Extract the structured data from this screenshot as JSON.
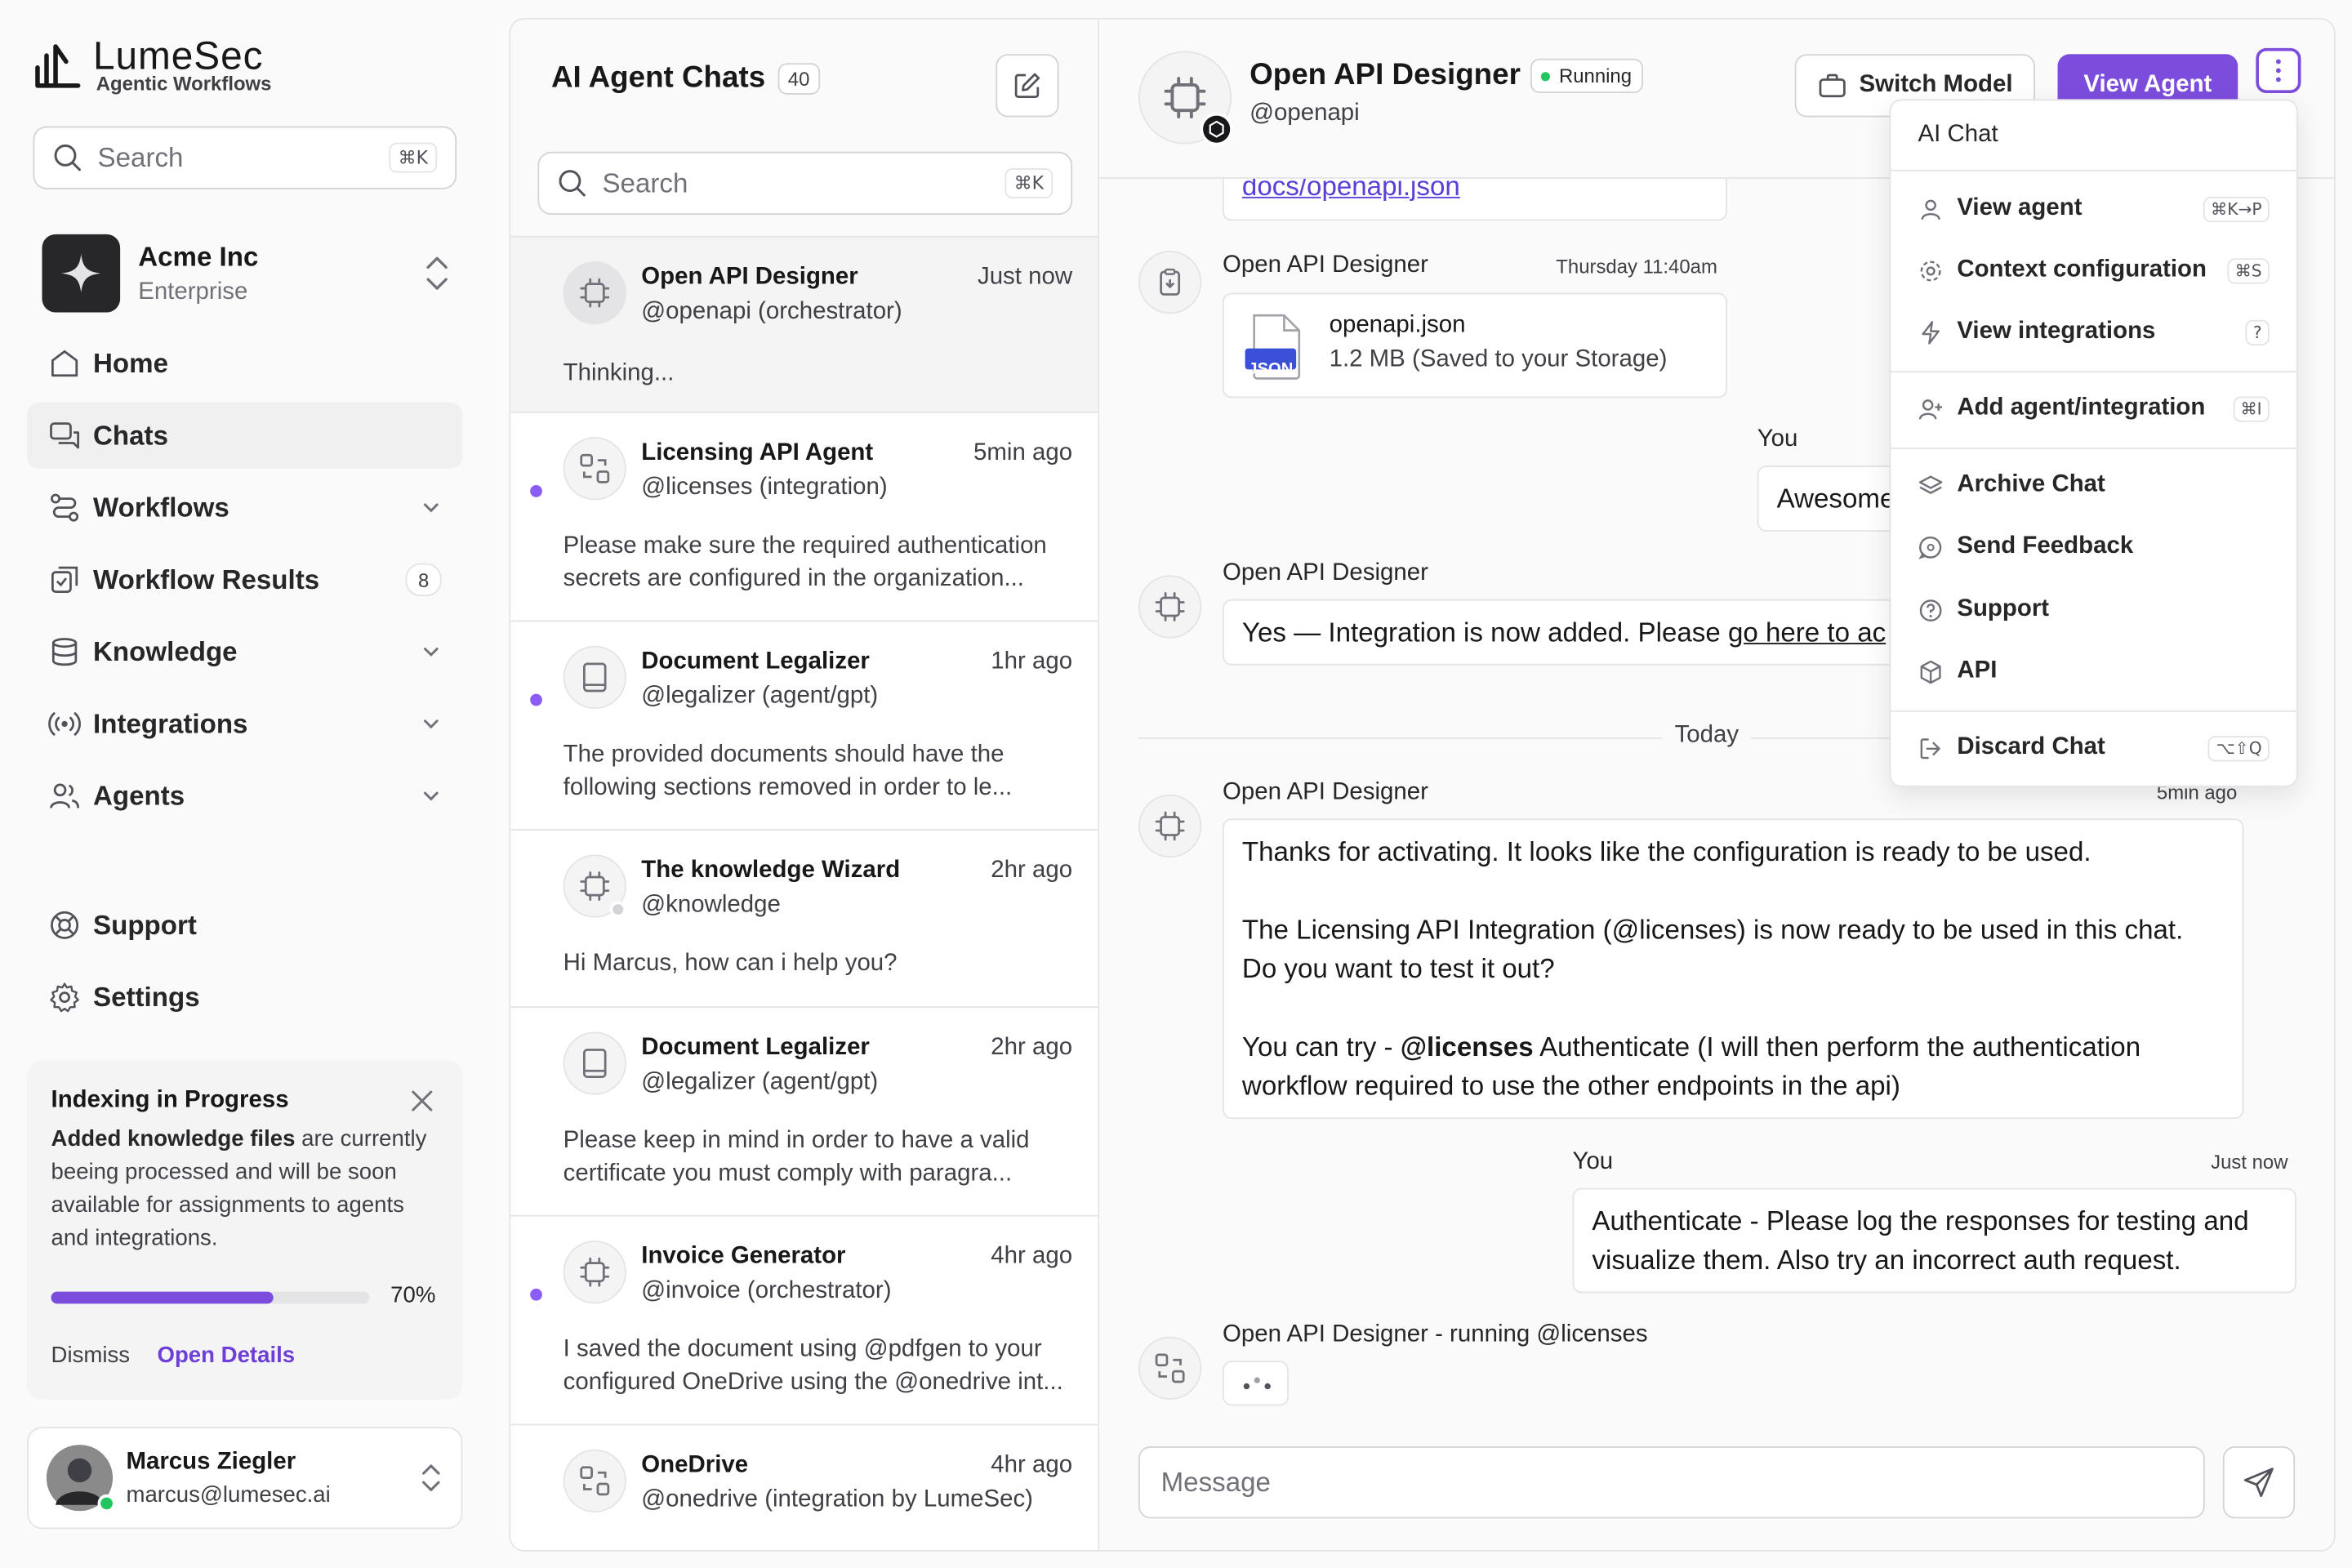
{
  "brand": {
    "name": "LumeSec",
    "tagline": "Agentic Workflows"
  },
  "sidebar": {
    "search": {
      "placeholder": "Search",
      "shortcut": "⌘K"
    },
    "org": {
      "name": "Acme Inc",
      "tier": "Enterprise"
    },
    "nav": [
      {
        "label": "Home",
        "icon": "home-icon"
      },
      {
        "label": "Chats",
        "icon": "chats-icon",
        "active": true
      },
      {
        "label": "Workflows",
        "icon": "workflows-icon"
      },
      {
        "label": "Workflow Results",
        "icon": "workflow-results-icon",
        "badge": "8"
      },
      {
        "label": "Knowledge",
        "icon": "database-icon"
      },
      {
        "label": "Integrations",
        "icon": "integrations-icon"
      },
      {
        "label": "Agents",
        "icon": "agents-icon"
      }
    ],
    "footer_nav": [
      {
        "label": "Support",
        "icon": "lifebuoy-icon"
      },
      {
        "label": "Settings",
        "icon": "gear-icon"
      }
    ],
    "indexing": {
      "title": "Indexing in Progress",
      "bold": "Added knowledge files",
      "body": " are currently beeing processed and will be soon available for assignments to agents and integrations.",
      "progress": 0.7,
      "progress_label": "70%",
      "dismiss": "Dismiss",
      "open": "Open Details"
    },
    "user": {
      "name": "Marcus Ziegler",
      "email": "marcus@lumesec.ai"
    }
  },
  "chat_list": {
    "title": "AI Agent Chats",
    "count": "40",
    "search": {
      "placeholder": "Search",
      "shortcut": "⌘K"
    },
    "items": [
      {
        "name": "Open API Designer",
        "handle": "@openapi (orchestrator)",
        "time": "Just now",
        "text": "Thinking...",
        "icon": "chip-icon",
        "selected": true
      },
      {
        "name": "Licensing API Agent",
        "handle": "@licenses (integration)",
        "time": "5min ago",
        "text": "Please make sure the required authentication secrets are configured in the organization...",
        "icon": "integration-icon",
        "unread": true
      },
      {
        "name": "Document Legalizer",
        "handle": "@legalizer (agent/gpt)",
        "time": "1hr ago",
        "text": "The provided documents should have the following sections removed in order to le...",
        "icon": "book-icon",
        "unread": true
      },
      {
        "name": "The knowledge Wizard",
        "handle": "@knowledge",
        "time": "2hr ago",
        "text": "Hi Marcus, how can i help you?",
        "icon": "chip-icon"
      },
      {
        "name": "Document Legalizer",
        "handle": "@legalizer (agent/gpt)",
        "time": "2hr ago",
        "text": "Please keep in mind in order to have a valid certificate you must comply with paragra...",
        "icon": "book-icon"
      },
      {
        "name": "Invoice Generator",
        "handle": "@invoice (orchestrator)",
        "time": "4hr ago",
        "text": "I saved the document using @pdfgen to your configured OneDrive using the @onedrive int...",
        "icon": "chip-icon",
        "unread": true
      },
      {
        "name": "OneDrive",
        "handle": "@onedrive (integration by LumeSec)",
        "time": "4hr ago",
        "text": "",
        "icon": "integration-icon"
      }
    ]
  },
  "chat": {
    "agent_name": "Open API Designer",
    "status": "Running",
    "handle": "@openapi",
    "switch_model": "Switch Model",
    "view_agent": "View Agent",
    "partial_link": "docs/openapi.json",
    "msg1": {
      "sender": "Open API Designer",
      "time": "Thursday 11:40am",
      "file_name": "openapi.json",
      "file_meta": "1.2 MB (Saved to your Storage)",
      "file_tag": "JSON"
    },
    "msg2": {
      "sender": "You",
      "text": "Awesome"
    },
    "msg3": {
      "sender": "Open API Designer",
      "text_prefix": "Yes — Integration is now added. Please ",
      "link": "go here to ac"
    },
    "divider": "Today",
    "msg4": {
      "sender": "Open API Designer",
      "time": "5min ago",
      "p1": "Thanks for activating. It looks like the configuration is ready to be used.",
      "p2": "The Licensing API Integration (@licenses) is now ready to be used in this chat. Do you want to test it out?",
      "p3_prefix": "You can try - ",
      "p3_bold": "@licenses",
      "p3_suffix": " Authenticate (I will then perform the authentication workflow required to use the other endpoints in the api)"
    },
    "msg5": {
      "sender": "You",
      "time": "Just now",
      "text": "Authenticate - Please log the responses for testing and visualize them. Also try an incorrect auth request."
    },
    "msg6": {
      "sender": "Open API Designer - running @licenses"
    },
    "composer_placeholder": "Message"
  },
  "menu": {
    "title": "AI Chat",
    "items": [
      {
        "label": "View agent",
        "shortcut": "⌘K→P",
        "icon": "user-icon"
      },
      {
        "label": "Context configuration",
        "shortcut": "⌘S",
        "icon": "gear-icon"
      },
      {
        "label": "View integrations",
        "shortcut": "?",
        "icon": "bolt-icon"
      },
      {
        "label": "Add agent/integration",
        "shortcut": "⌘I",
        "icon": "user-plus-icon"
      },
      {
        "label": "Archive Chat",
        "icon": "archive-icon"
      },
      {
        "label": "Send Feedback",
        "icon": "feedback-icon"
      },
      {
        "label": "Support",
        "icon": "help-icon"
      },
      {
        "label": "API",
        "icon": "cube-icon"
      },
      {
        "label": "Discard Chat",
        "shortcut": "⌥⇧Q",
        "icon": "logout-icon"
      }
    ]
  },
  "colors": {
    "accent": "#7c4ddc",
    "online": "#22c55e",
    "unread": "#8b5cf6"
  }
}
